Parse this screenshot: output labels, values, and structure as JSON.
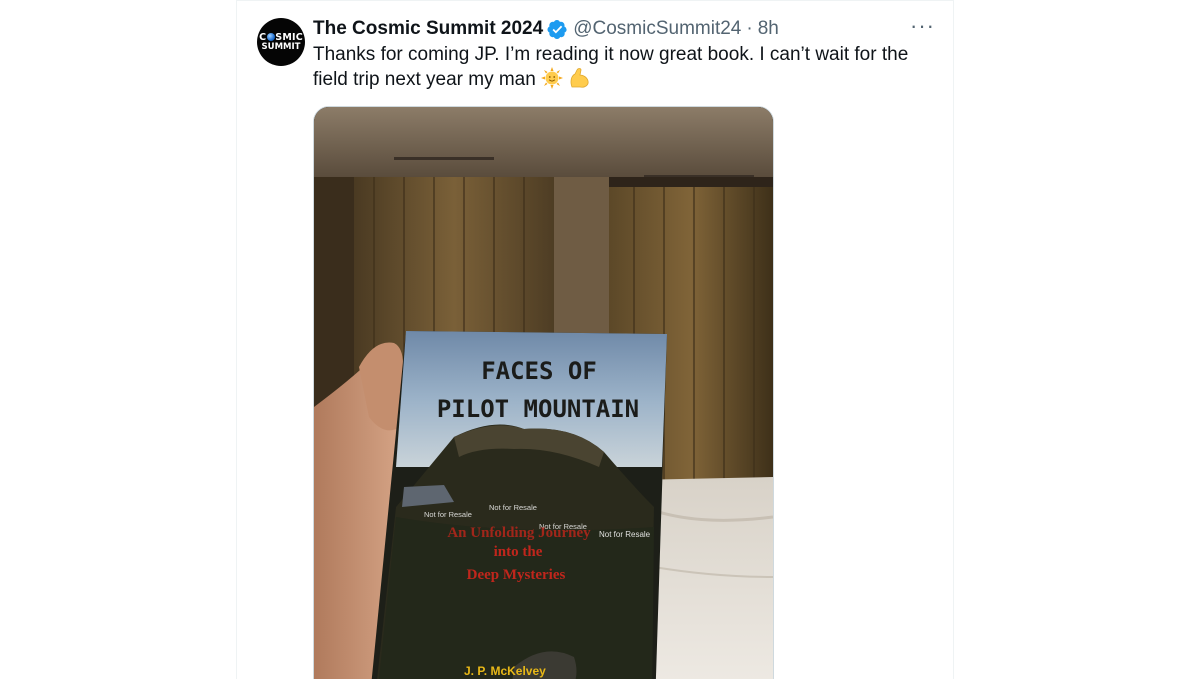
{
  "tweet": {
    "display_name": "The Cosmic Summit 2024",
    "handle": "@CosmicSummit24",
    "separator": "·",
    "time": "8h",
    "more_label": "···",
    "text": "Thanks for coming JP. I’m reading it now great book. I can’t wait for the field trip next year my man",
    "emojis": [
      "sun-with-face",
      "flexed-biceps"
    ]
  },
  "avatar": {
    "line1_a": "C",
    "line1_b": "SMIC",
    "line2": "SUMMIT"
  },
  "book": {
    "title_line1": "FACES OF",
    "title_line2": "PILOT MOUNTAIN",
    "subtitle_line1": "An Unfolding Journey",
    "subtitle_line2": "into the",
    "subtitle_line3": "Deep Mysteries",
    "stamp": "Not for Resale",
    "author": "J. P. McKelvey"
  },
  "colors": {
    "verified": "#1d9bf0",
    "text": "#0f1419",
    "secondary": "#536471",
    "subtitle_red": "#c0261c",
    "author_yellow": "#e8b817"
  }
}
